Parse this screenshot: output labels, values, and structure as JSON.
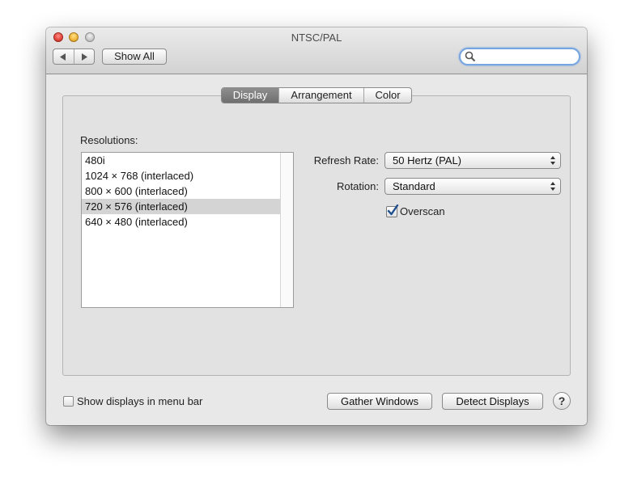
{
  "window": {
    "title": "NTSC/PAL"
  },
  "toolbar": {
    "back_icon": "back-arrow-icon",
    "forward_icon": "forward-arrow-icon",
    "show_all_label": "Show All",
    "search_value": "",
    "search_icon": "magnifier-icon"
  },
  "tabs": [
    {
      "label": "Display",
      "active": true
    },
    {
      "label": "Arrangement",
      "active": false
    },
    {
      "label": "Color",
      "active": false
    }
  ],
  "resolutions": {
    "label": "Resolutions:",
    "items": [
      "480i",
      "1024 × 768 (interlaced)",
      "800 × 600 (interlaced)",
      "720 × 576 (interlaced)",
      "640 × 480 (interlaced)"
    ],
    "selected_index": 3
  },
  "refresh_rate": {
    "label": "Refresh Rate:",
    "value": "50 Hertz (PAL)"
  },
  "rotation": {
    "label": "Rotation:",
    "value": "Standard"
  },
  "overscan": {
    "label": "Overscan",
    "checked": true
  },
  "footer": {
    "menubar_label": "Show displays in menu bar",
    "menubar_checked": false,
    "gather_label": "Gather Windows",
    "detect_label": "Detect Displays",
    "help_label": "?"
  },
  "colors": {
    "selection": "#d4d4d4",
    "active_tab": "#7a7a7a",
    "search_focus": "#76a5e0",
    "checkmark": "#1f4f8f"
  }
}
